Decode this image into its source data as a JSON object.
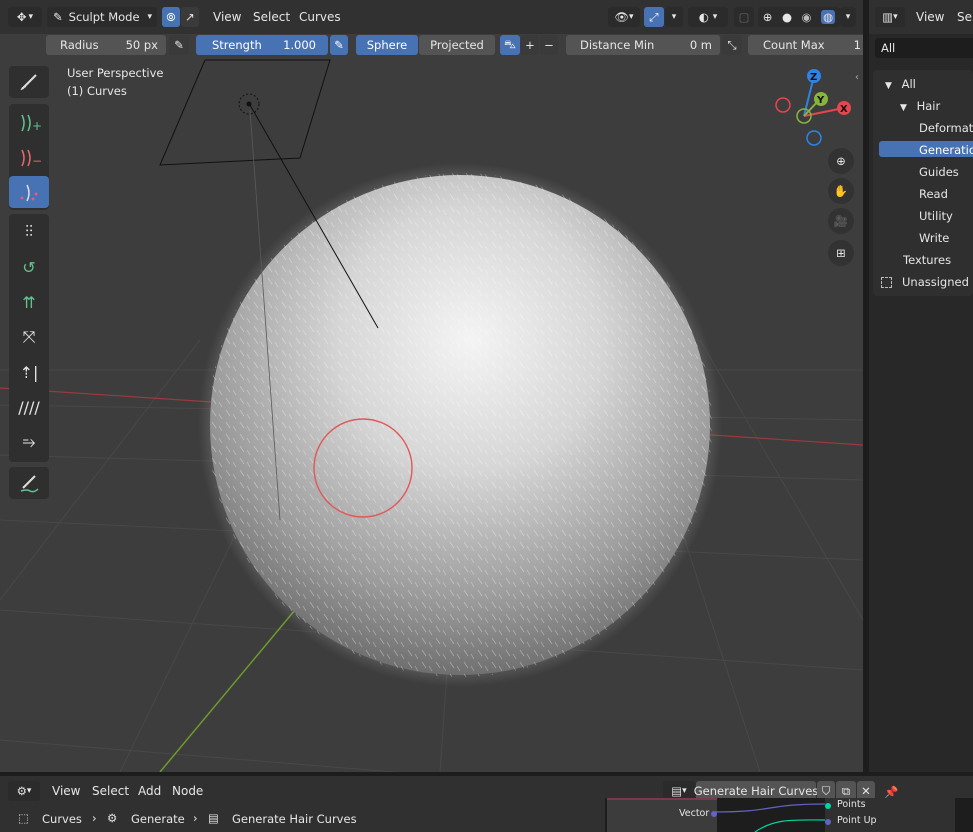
{
  "header": {
    "mode_label": "Sculpt Mode",
    "menus": [
      "View",
      "Select",
      "Curves"
    ]
  },
  "tool_settings": {
    "radius_label": "Radius",
    "radius_value": "50 px",
    "strength_label": "Strength",
    "strength_value": "1.000",
    "falloff_options": [
      "Sphere",
      "Projected"
    ],
    "distance_min_label": "Distance Min",
    "distance_min_value": "0 m",
    "count_max_label": "Count Max",
    "count_max_value": "1"
  },
  "viewport": {
    "perspective_label": "User Perspective",
    "object_label": "(1) Curves",
    "gizmo_axes": {
      "x": "X",
      "y": "Y",
      "z": "Z"
    }
  },
  "outliner": {
    "header_menus": [
      "View",
      "Sel"
    ],
    "filter_value": "All",
    "items": [
      {
        "label": "All"
      },
      {
        "label": "Hair"
      },
      {
        "label": "Deformation"
      },
      {
        "label": "Generation"
      },
      {
        "label": "Guides"
      },
      {
        "label": "Read"
      },
      {
        "label": "Utility"
      },
      {
        "label": "Write"
      },
      {
        "label": "Textures"
      },
      {
        "label": "Unassigned"
      }
    ]
  },
  "node_editor": {
    "menus": [
      "View",
      "Select",
      "Add",
      "Node"
    ],
    "node_group_name": "Generate Hair Curves",
    "breadcrumb": [
      "Curves",
      "Generate",
      "Generate Hair Curves"
    ],
    "sockets": {
      "input": "Vector",
      "output1": "Points",
      "output2": "Point Up"
    }
  },
  "colors": {
    "accent": "#4772b3",
    "viewport_bg": "#3d3d3d",
    "x_axis": "#e6464e",
    "y_axis": "#87b53b",
    "z_axis": "#2e83e6"
  }
}
